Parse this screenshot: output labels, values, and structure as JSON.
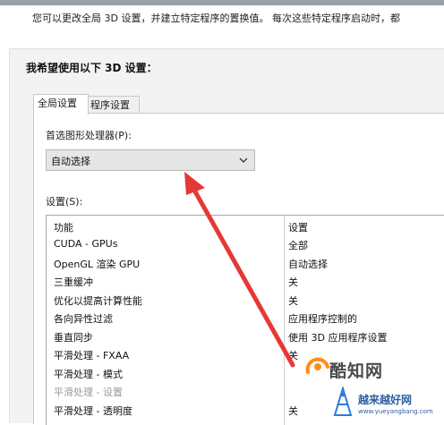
{
  "header": {
    "intro_text": "您可以更改全局 3D 设置，并建立特定程序的置换值。 每次这些特定程序启动时，都"
  },
  "panel": {
    "title": "我希望使用以下 3D 设置："
  },
  "tabs": [
    {
      "label": "全局设置",
      "active": true
    },
    {
      "label": "程序设置",
      "active": false
    }
  ],
  "processor": {
    "label": "首选图形处理器(P):",
    "selected": "自动选择"
  },
  "settings": {
    "label": "设置(S):",
    "columns": {
      "feature": "功能",
      "setting": "设置"
    },
    "rows": [
      {
        "feature": "CUDA - GPUs",
        "value": "全部"
      },
      {
        "feature": "OpenGL 渲染 GPU",
        "value": "自动选择"
      },
      {
        "feature": "三重缓冲",
        "value": "关"
      },
      {
        "feature": "优化以提高计算性能",
        "value": "关"
      },
      {
        "feature": "各向异性过滤",
        "value": "应用程序控制的"
      },
      {
        "feature": "垂直同步",
        "value": "使用 3D 应用程序设置"
      },
      {
        "feature": "平滑处理 - FXAA",
        "value": "关"
      },
      {
        "feature": "平滑处理 - 模式",
        "value": ""
      },
      {
        "feature": "平滑处理 - 设置",
        "value": ""
      },
      {
        "feature": "平滑处理 - 透明度",
        "value": "关"
      }
    ]
  },
  "watermark": {
    "brand": "酷知网",
    "sub": "越来越好网",
    "url": "www.yueyangbang.com"
  },
  "colors": {
    "arrow": "#e53935",
    "panel_bg": "#f3f3f3",
    "select_bg": "#e6e6e6",
    "watermark_blue": "#2e5f9e"
  }
}
